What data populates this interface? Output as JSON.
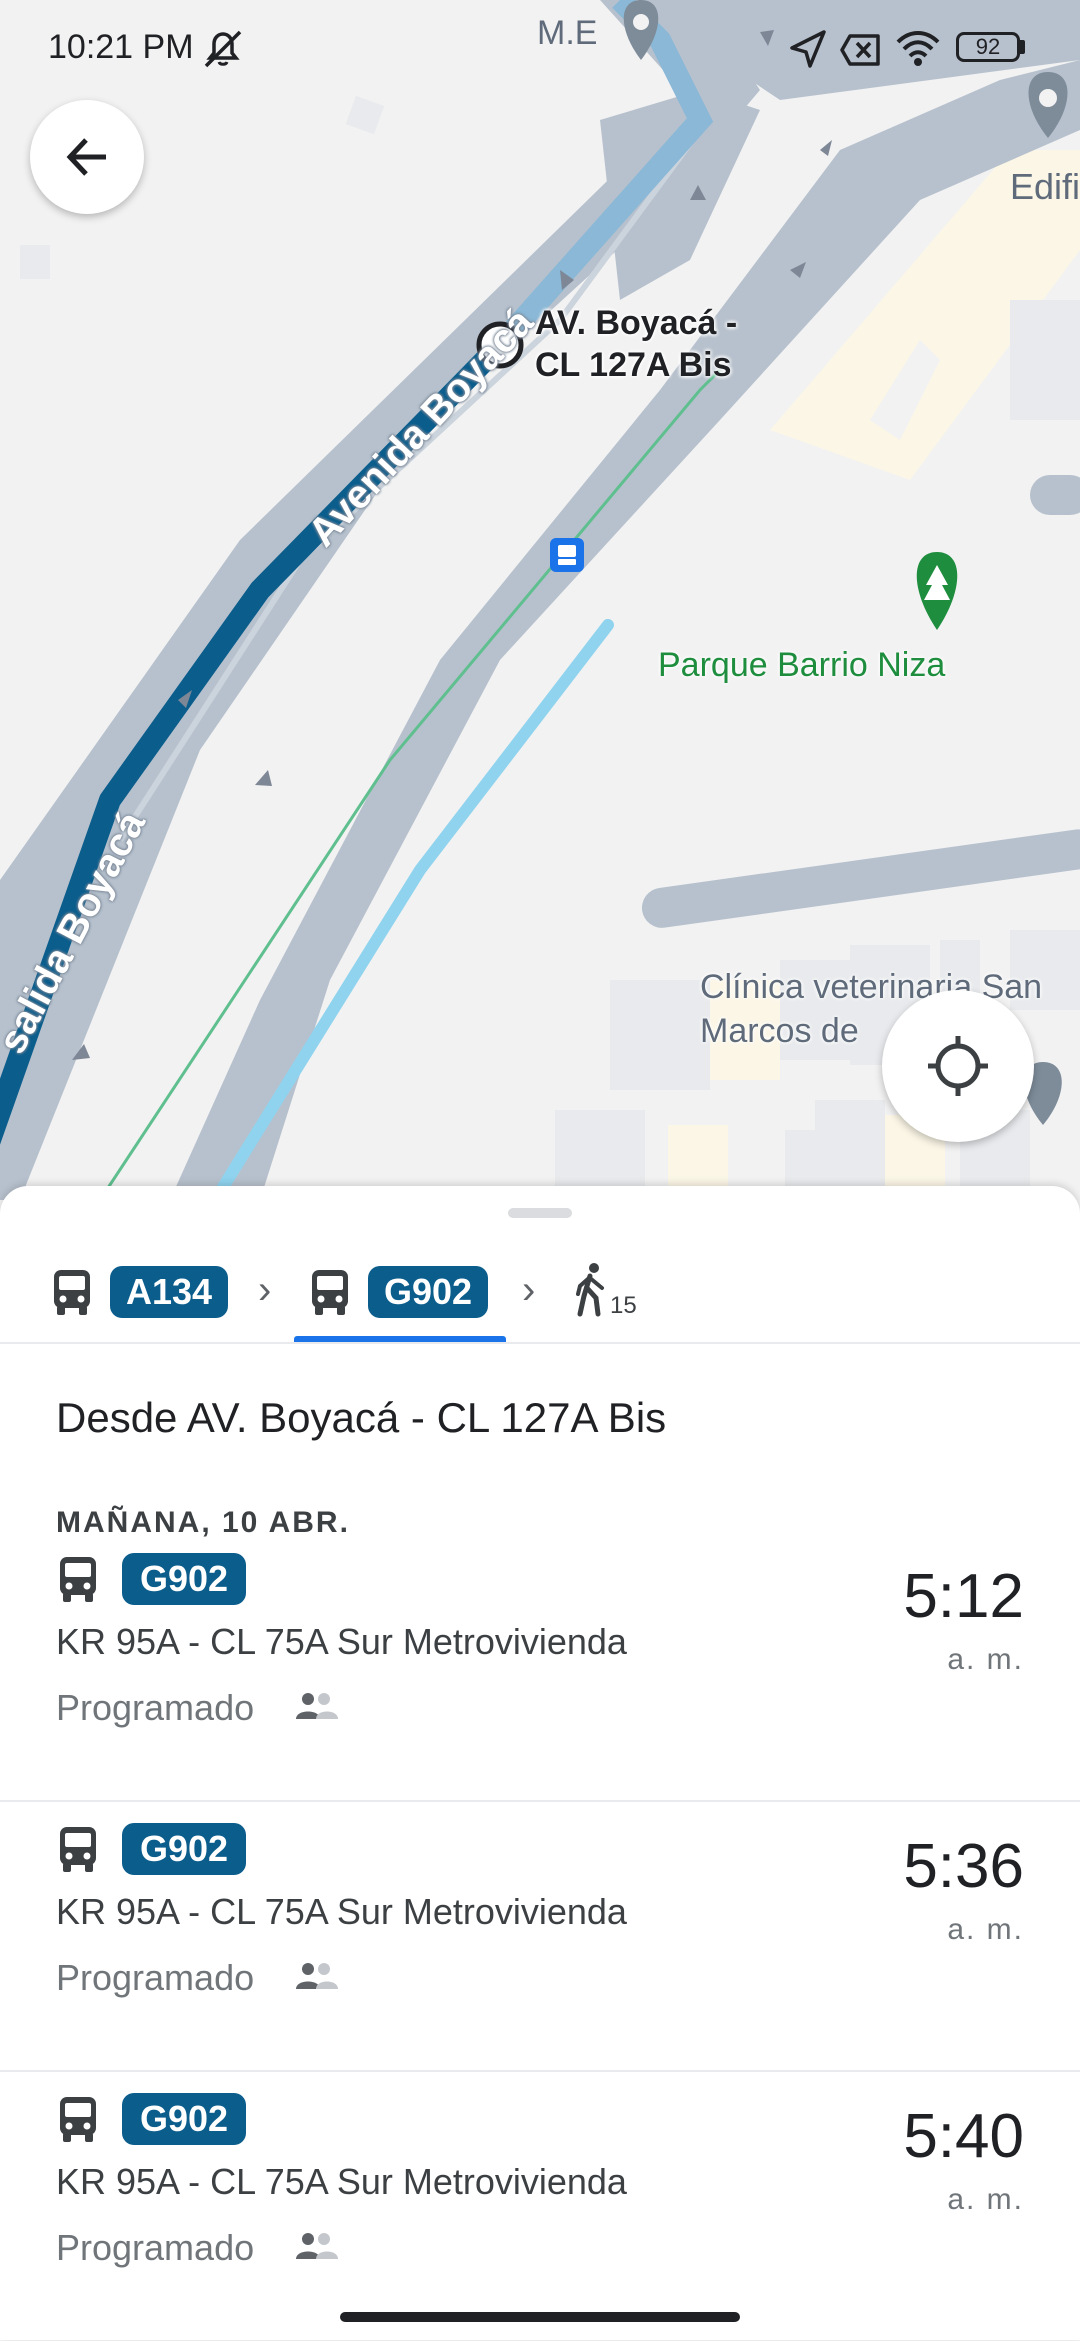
{
  "status_bar": {
    "time": "10:21 PM",
    "battery": "92"
  },
  "map": {
    "stop_label_line1": "AV. Boyacá -",
    "stop_label_line2": "CL 127A Bis",
    "road_label_1": "Avenida Boyacá",
    "road_label_2": "salida Boyacá",
    "park_label": "Parque Barrio Niza",
    "vet_label_line1": "Clínica veterinaria San",
    "vet_label_line2": "Marcos de        TDA",
    "place_me": "M.E",
    "place_edif": "Edifi"
  },
  "route_bar": {
    "segments": [
      {
        "route": "A134",
        "icon": "bus-icon"
      },
      {
        "route": "G902",
        "icon": "bus-icon"
      }
    ],
    "walk_minutes": "15"
  },
  "stop_title": "Desde AV. Boyacá - CL 127A Bis",
  "date_heading": "MAÑANA, 10 ABR.",
  "departures": [
    {
      "route": "G902",
      "destination": "KR 95A - CL 75A Sur Metrovivienda",
      "status": "Programado",
      "time": "5:12",
      "ampm": "a. m."
    },
    {
      "route": "G902",
      "destination": "KR 95A - CL 75A Sur Metrovivienda",
      "status": "Programado",
      "time": "5:36",
      "ampm": "a. m."
    },
    {
      "route": "G902",
      "destination": "KR 95A - CL 75A Sur Metrovivienda",
      "status": "Programado",
      "time": "5:40",
      "ampm": "a. m."
    }
  ],
  "colors": {
    "route_badge": "#0b5d8c",
    "tab_active": "#1a73e8",
    "route_line": "#0b5d8c"
  }
}
